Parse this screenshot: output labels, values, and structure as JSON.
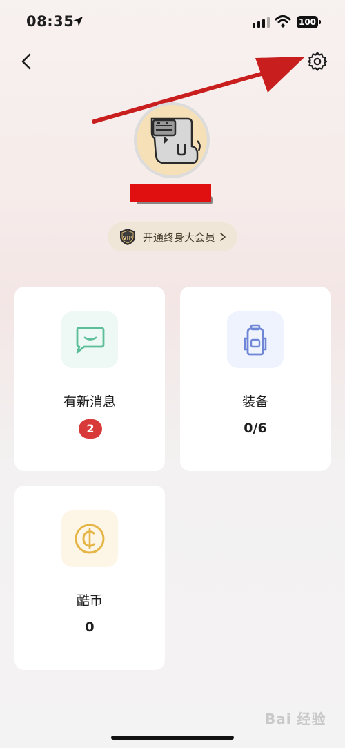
{
  "status_bar": {
    "time": "08:35",
    "battery": "100"
  },
  "profile": {
    "vip_label": "开通终身大会员"
  },
  "cards": [
    {
      "title": "有新消息",
      "value": "2"
    },
    {
      "title": "装备",
      "value": "0/6"
    },
    {
      "title": "酷币",
      "value": "0"
    }
  ],
  "colors": {
    "accent_red": "#d83a3a",
    "annotation_arrow": "#c81e1e",
    "messages_icon": "#5dbf9a",
    "equipment_icon": "#6f86d6",
    "coin_icon": "#e5b545"
  },
  "watermark": "Bai 经验"
}
